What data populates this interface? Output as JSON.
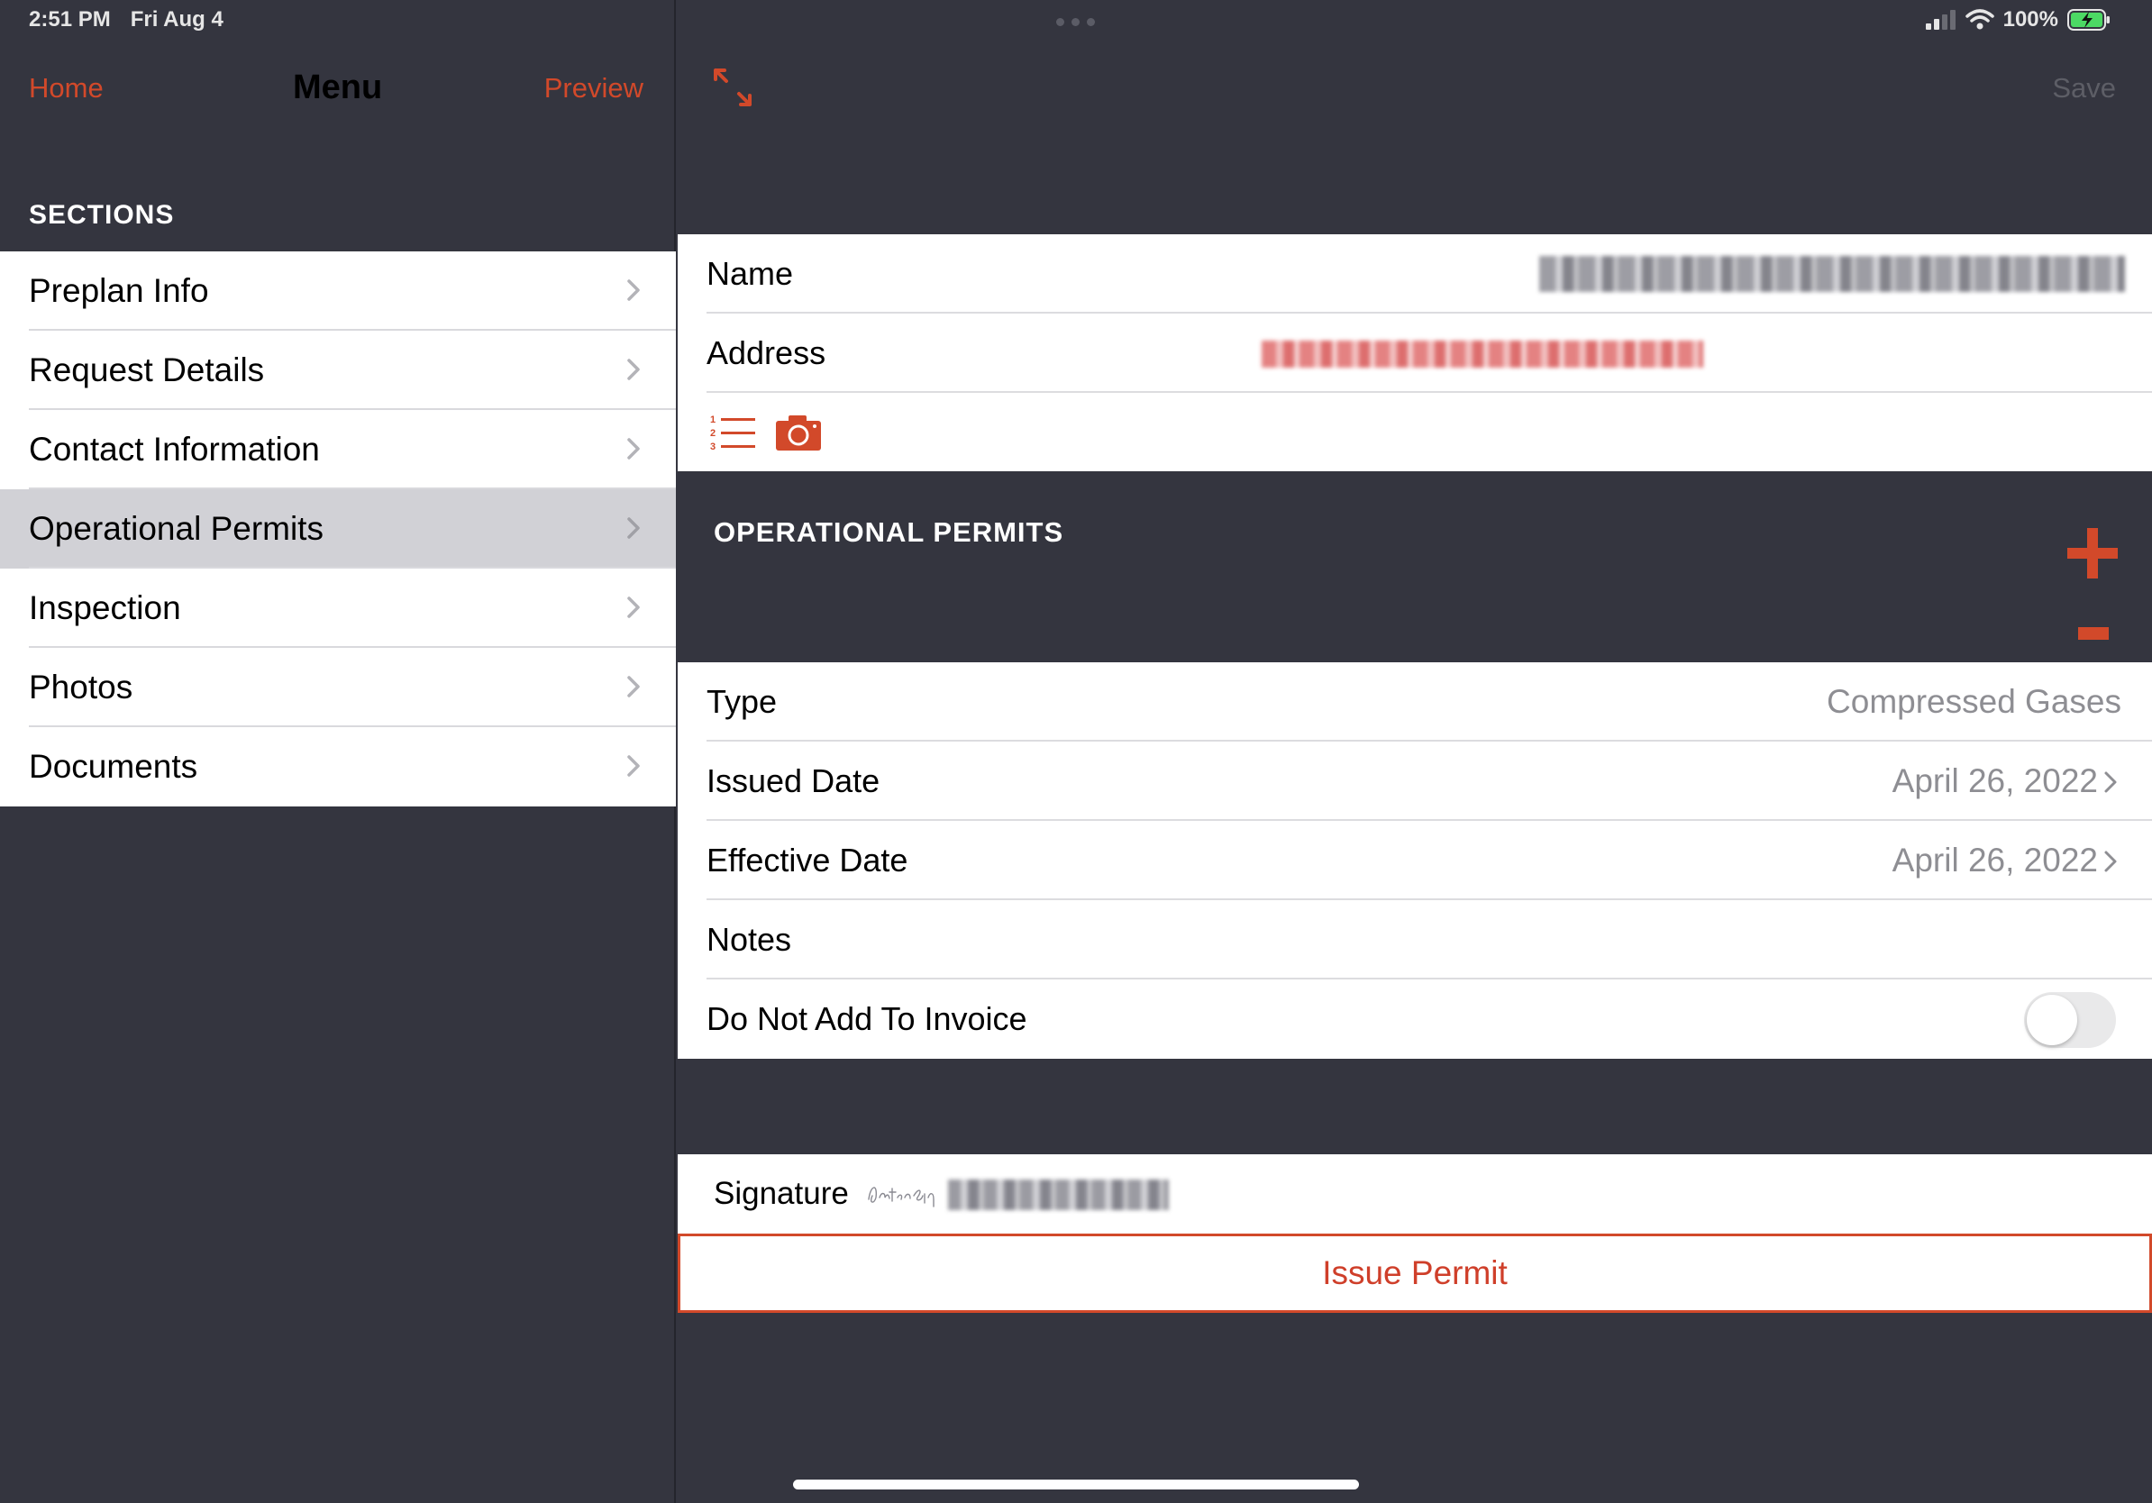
{
  "status_bar": {
    "time": "2:51 PM",
    "date": "Fri Aug 4",
    "battery": "100%"
  },
  "colors": {
    "accent": "#d2492a",
    "background": "#34353f",
    "selected_row": "#d1d1d6",
    "value_text": "#8e8e93"
  },
  "left_nav": {
    "home_label": "Home",
    "title": "Menu",
    "preview_label": "Preview"
  },
  "sections": {
    "header": "SECTIONS",
    "items": [
      {
        "label": "Preplan Info"
      },
      {
        "label": "Request Details"
      },
      {
        "label": "Contact Information"
      },
      {
        "label": "Operational Permits",
        "selected": true
      },
      {
        "label": "Inspection"
      },
      {
        "label": "Photos"
      },
      {
        "label": "Documents"
      }
    ]
  },
  "right_nav": {
    "expand_icon": "expand-arrows-icon",
    "save_label": "Save"
  },
  "info": {
    "name_label": "Name",
    "address_label": "Address",
    "toolbar_icons": [
      "numbered-list-icon",
      "camera-icon"
    ]
  },
  "permits": {
    "header": "OPERATIONAL PERMITS",
    "add_icon": "plus-icon",
    "remove_icon": "minus-icon",
    "type_label": "Type",
    "type_value": "Compressed Gases",
    "issued_label": "Issued Date",
    "issued_value": "April 26, 2022",
    "effective_label": "Effective Date",
    "effective_value": "April 26, 2022",
    "notes_label": "Notes",
    "invoice_label": "Do Not Add To Invoice",
    "invoice_toggle_on": false
  },
  "signature": {
    "label": "Signature"
  },
  "issue_button": {
    "label": "Issue Permit"
  }
}
